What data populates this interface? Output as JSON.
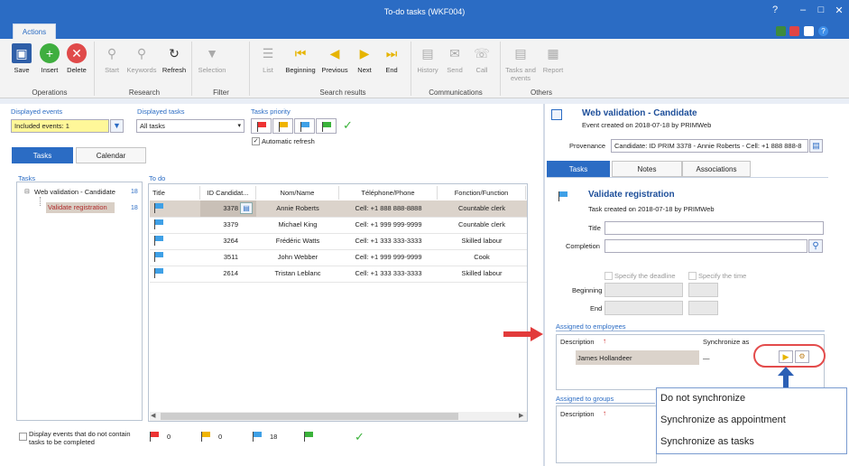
{
  "window": {
    "title": "To-do tasks (WKF004)",
    "menu_tab": "Actions"
  },
  "ribbon": {
    "buttons": {
      "save": "Save",
      "insert": "Insert",
      "delete": "Delete",
      "start": "Start",
      "keywords": "Keywords",
      "refresh": "Refresh",
      "selection": "Selection",
      "list": "List",
      "beginning": "Beginning",
      "previous": "Previous",
      "next": "Next",
      "end": "End",
      "history": "History",
      "send": "Send",
      "call": "Call",
      "tasks_events": "Tasks and events",
      "report": "Report"
    },
    "groups": {
      "operations": "Operations",
      "research": "Research",
      "filter": "Filter",
      "search_results": "Search results",
      "communications": "Communications",
      "others": "Others"
    }
  },
  "filters": {
    "displayed_events_label": "Displayed events",
    "displayed_events_value": "Included events: 1",
    "displayed_tasks_label": "Displayed tasks",
    "displayed_tasks_value": "All tasks",
    "tasks_priority_label": "Tasks priority",
    "automatic_refresh": "Automatic refresh"
  },
  "left_tabs": {
    "tasks": "Tasks",
    "calendar": "Calendar"
  },
  "tasks_tree": {
    "label": "Tasks",
    "items": [
      {
        "label": "Web validation - Candidate",
        "count": "18"
      },
      {
        "label": "Validate registration",
        "count": "18"
      }
    ]
  },
  "todo": {
    "label": "To do",
    "columns": [
      "Title",
      "ID Candidat...",
      "Nom/Name",
      "Téléphone/Phone",
      "Fonction/Function"
    ],
    "rows": [
      {
        "id": "3378",
        "name": "Annie Roberts",
        "phone": "Cell: +1 888 888-8888",
        "function": "Countable clerk"
      },
      {
        "id": "3379",
        "name": "Michael King",
        "phone": "Cell: +1 999 999-9999",
        "function": "Countable clerk"
      },
      {
        "id": "3264",
        "name": "Frédéric Watts",
        "phone": "Cell: +1 333 333-3333",
        "function": "Skilled labour"
      },
      {
        "id": "3511",
        "name": "John Webber",
        "phone": "Cell: +1 999 999-9999",
        "function": "Cook"
      },
      {
        "id": "2614",
        "name": "Tristan Leblanc",
        "phone": "Cell: +1 333 333-3333",
        "function": "Skilled labour"
      }
    ]
  },
  "footer": {
    "display_events": "Display events that do not contain tasks to be completed",
    "counts": {
      "red": "0",
      "yellow": "0",
      "blue": "18"
    }
  },
  "detail": {
    "event_title": "Web validation - Candidate",
    "event_created": "Event created on 2018-07-18 by PRIMWeb",
    "provenance_label": "Provenance",
    "provenance_value": "Candidate: ID PRIM 3378 - Annie Roberts - Cell: +1 888 888-8",
    "tabs": {
      "tasks": "Tasks",
      "notes": "Notes",
      "associations": "Associations"
    },
    "task_title": "Validate registration",
    "task_created": "Task created on 2018-07-18 by PRIMWeb",
    "title_label": "Title",
    "completion_label": "Completion",
    "deadline": "Specify the deadline",
    "time": "Specify the time",
    "beginning_label": "Beginning",
    "end_label": "End",
    "assigned_employees": "Assigned to employees",
    "description_col": "Description",
    "sync_col": "Synchronize as",
    "employee": "James Hollandeer",
    "sync_value": "—",
    "assigned_groups": "Assigned to groups"
  },
  "popup": {
    "options": [
      "Do not synchronize",
      "Synchronize as appointment",
      "Synchronize as tasks"
    ]
  },
  "colors": {
    "accent": "#2b6cc4",
    "highlight": "#fff799",
    "callout": "#e23b3b"
  }
}
